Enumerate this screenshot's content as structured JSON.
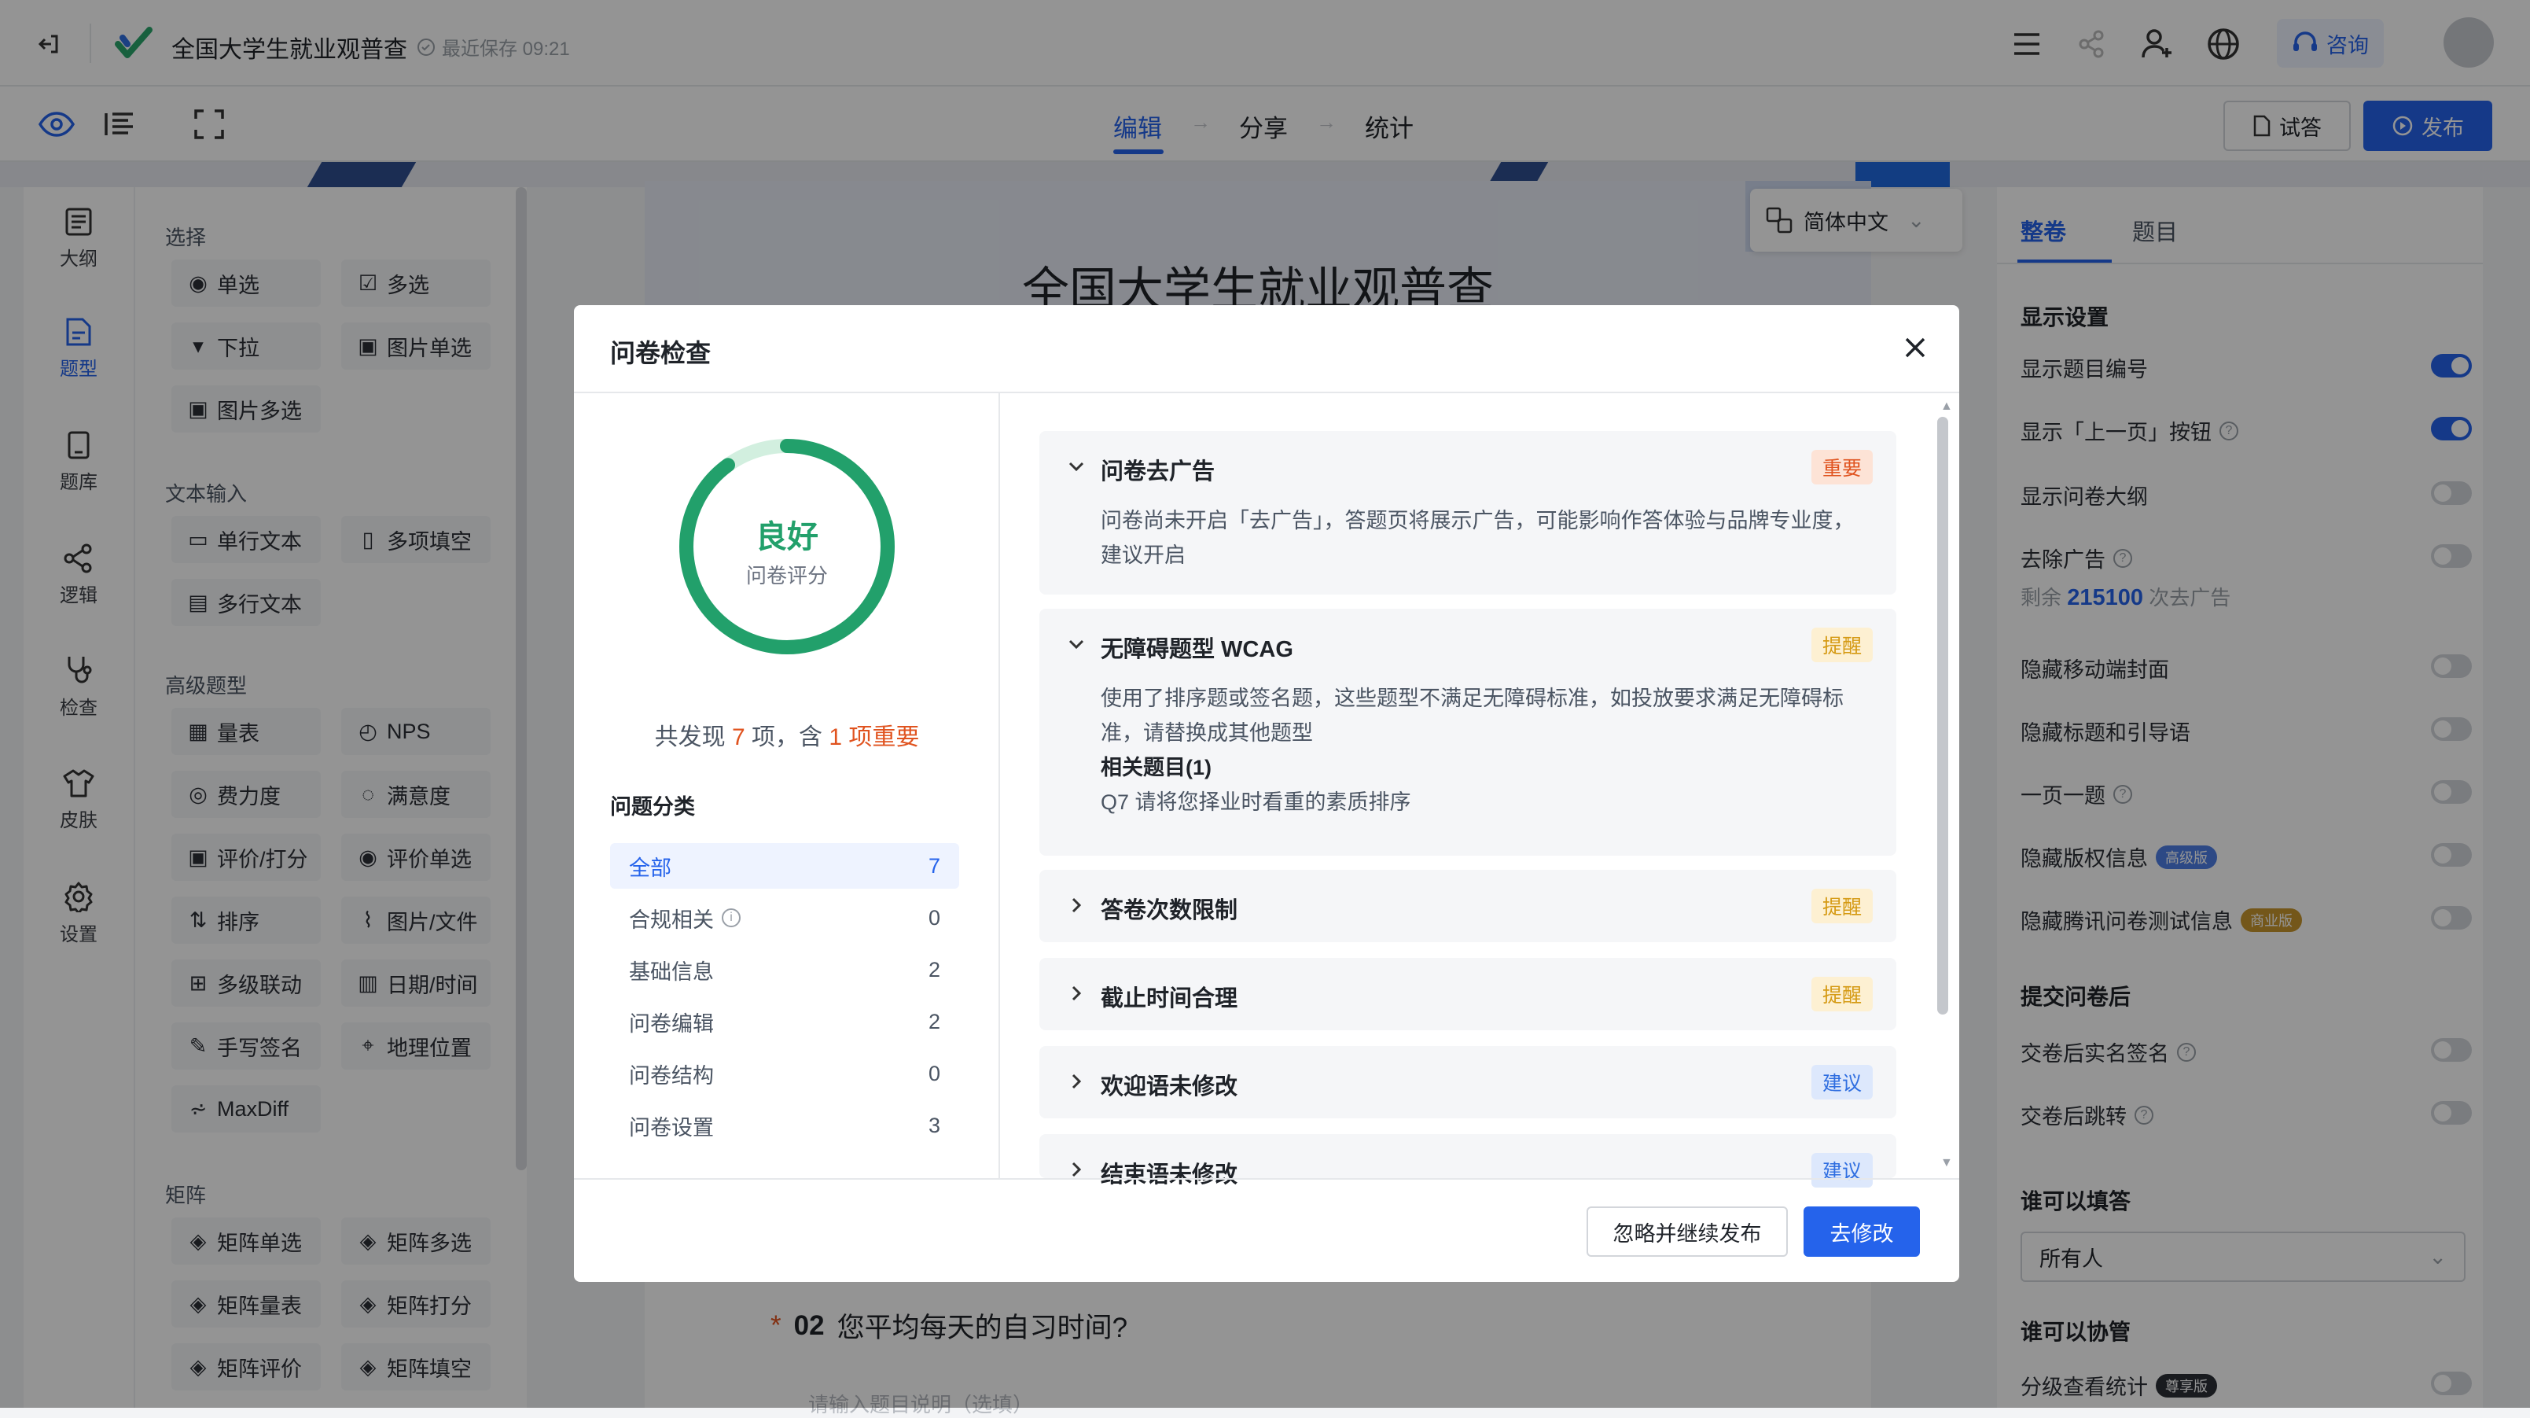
{
  "app": {
    "title": "全国大学生就业观普查",
    "save_status": "最近保存 09:21",
    "consult": "咨询"
  },
  "steps": [
    "编辑",
    "分享",
    "统计"
  ],
  "toolbar": {
    "preview": "试答",
    "publish": "发布"
  },
  "rail": [
    {
      "label": "大纲",
      "icon": "outline-icon"
    },
    {
      "label": "题型",
      "icon": "question-type-icon",
      "active": true
    },
    {
      "label": "题库",
      "icon": "question-bank-icon"
    },
    {
      "label": "逻辑",
      "icon": "logic-icon"
    },
    {
      "label": "检查",
      "icon": "check-icon"
    },
    {
      "label": "皮肤",
      "icon": "skin-icon"
    },
    {
      "label": "设置",
      "icon": "settings-icon"
    }
  ],
  "palette": {
    "sections": {
      "choice": "选择",
      "text": "文本输入",
      "advanced": "高级题型",
      "matrix": "矩阵"
    },
    "choice": [
      {
        "label": "单选",
        "glyph": "◉"
      },
      {
        "label": "多选",
        "glyph": "☑"
      },
      {
        "label": "下拉",
        "glyph": "▾"
      },
      {
        "label": "图片单选",
        "glyph": "▣"
      },
      {
        "label": "图片多选",
        "glyph": "▣"
      }
    ],
    "text": [
      {
        "label": "单行文本",
        "glyph": "▭"
      },
      {
        "label": "多项填空",
        "glyph": "▯"
      },
      {
        "label": "多行文本",
        "glyph": "▤"
      }
    ],
    "advanced": [
      {
        "label": "量表",
        "glyph": "▦"
      },
      {
        "label": "NPS",
        "glyph": "◴"
      },
      {
        "label": "费力度",
        "glyph": "◎"
      },
      {
        "label": "满意度",
        "glyph": "◌"
      },
      {
        "label": "评价/打分",
        "glyph": "▣"
      },
      {
        "label": "评价单选",
        "glyph": "◉"
      },
      {
        "label": "排序",
        "glyph": "⇅"
      },
      {
        "label": "图片/文件",
        "glyph": "⌇"
      },
      {
        "label": "多级联动",
        "glyph": "⊞"
      },
      {
        "label": "日期/时间",
        "glyph": "▥"
      },
      {
        "label": "手写签名",
        "glyph": "✎"
      },
      {
        "label": "地理位置",
        "glyph": "⌖"
      },
      {
        "label": "MaxDiff",
        "glyph": "⩫"
      }
    ],
    "matrix": [
      {
        "label": "矩阵单选",
        "glyph": "◈"
      },
      {
        "label": "矩阵多选",
        "glyph": "◈"
      },
      {
        "label": "矩阵量表",
        "glyph": "◈"
      },
      {
        "label": "矩阵打分",
        "glyph": "◈"
      },
      {
        "label": "矩阵评价",
        "glyph": "◈"
      },
      {
        "label": "矩阵填空",
        "glyph": "◈"
      }
    ]
  },
  "canvas": {
    "language": "简体中文",
    "title": "全国大学生就业观普查",
    "question_num": "02",
    "question_text": "您平均每天的自习时间?",
    "question_desc_placeholder": "请输入题目说明（选填）"
  },
  "right_panel": {
    "tabs": [
      "整卷",
      "题目"
    ],
    "display_heading": "显示设置",
    "display": [
      {
        "label": "显示题目编号",
        "on": true
      },
      {
        "label": "显示「上一页」按钮",
        "help": true,
        "on": true
      },
      {
        "label": "显示问卷大纲",
        "on": false
      },
      {
        "label": "去除广告",
        "help": true,
        "on": false
      },
      {
        "label": "隐藏移动端封面",
        "on": false
      },
      {
        "label": "隐藏标题和引导语",
        "on": false
      },
      {
        "label": "一页一题",
        "help": true,
        "on": false
      },
      {
        "label": "隐藏版权信息",
        "badge": "高级版",
        "on": false
      },
      {
        "label": "隐藏腾讯问卷测试信息",
        "badge": "商业版",
        "on": false
      }
    ],
    "ads_remaining_prefix": "剩余",
    "ads_remaining_value": "215100",
    "ads_remaining_suffix": "次去广告",
    "submit_heading": "提交问卷后",
    "submit": [
      {
        "label": "交卷后实名签名",
        "help": true,
        "on": false
      },
      {
        "label": "交卷后跳转",
        "help": true,
        "on": false
      }
    ],
    "who_fill_heading": "谁可以填答",
    "who_fill_value": "所有人",
    "who_collab_heading": "谁可以协管",
    "collab_row": {
      "label": "分级查看统计",
      "badge": "尊享版",
      "on": false
    }
  },
  "modal": {
    "title": "问卷检查",
    "score_label": "良好",
    "score_sub": "问卷评分",
    "score_fraction": 0.9,
    "summary_prefix": "共发现",
    "summary_count": "7",
    "summary_mid": "项，含",
    "summary_important": "1 项重要",
    "category_heading": "问题分类",
    "categories": [
      {
        "label": "全部",
        "count": "7",
        "active": true
      },
      {
        "label": "合规相关",
        "count": "0",
        "info": true
      },
      {
        "label": "基础信息",
        "count": "2"
      },
      {
        "label": "问卷编辑",
        "count": "2"
      },
      {
        "label": "问卷结构",
        "count": "0"
      },
      {
        "label": "问卷设置",
        "count": "3"
      }
    ],
    "issues": [
      {
        "title": "问卷去广告",
        "tag": "重要",
        "level": "imp",
        "expanded": true,
        "desc": "问卷尚未开启「去广告」，答题页将展示广告，可能影响作答体验与品牌专业度，建议开启"
      },
      {
        "title": "无障碍题型 WCAG",
        "tag": "提醒",
        "level": "warn",
        "expanded": true,
        "desc": "使用了排序题或签名题，这些题型不满足无障碍标准，如投放要求满足无障碍标准，请替换成其他题型",
        "related_label": "相关题目(1)",
        "related_item": "Q7 请将您择业时看重的素质排序"
      },
      {
        "title": "答卷次数限制",
        "tag": "提醒",
        "level": "warn"
      },
      {
        "title": "截止时间合理",
        "tag": "提醒",
        "level": "warn"
      },
      {
        "title": "欢迎语未修改",
        "tag": "建议",
        "level": "sug"
      },
      {
        "title": "结束语未修改",
        "tag": "建议",
        "level": "sug"
      }
    ],
    "ignore_button": "忽略并继续发布",
    "fix_button": "去修改"
  },
  "colors": {
    "accent": "#2563eb",
    "score_ring": "#22a06b",
    "important": "#e0531f"
  }
}
